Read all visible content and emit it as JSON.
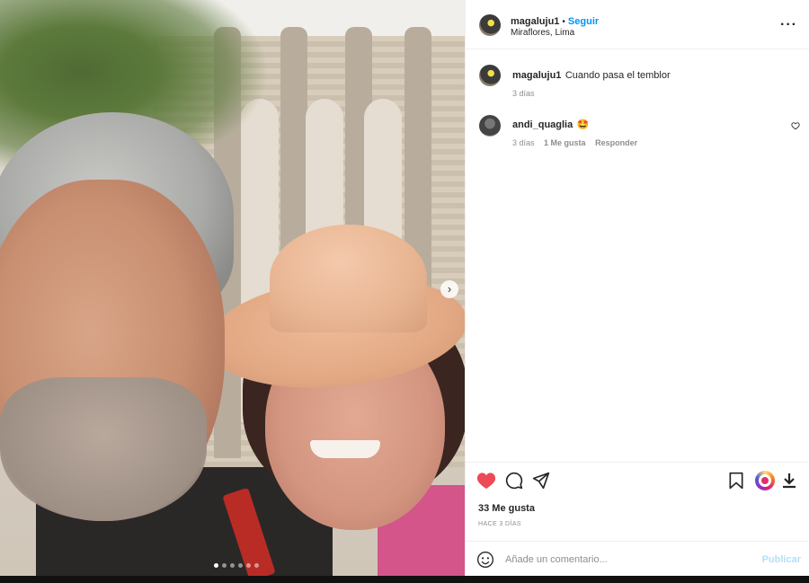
{
  "post": {
    "username": "magaluju1",
    "follow_label": "Seguir",
    "separator": "•",
    "location": "Miraflores, Lima",
    "more_label": "···",
    "carousel": {
      "total": 6,
      "active_index": 0
    }
  },
  "caption": {
    "username": "magaluju1",
    "text": "Cuando pasa el temblor",
    "time": "3 días"
  },
  "comments": [
    {
      "username": "andi_quaglia",
      "text": "🤩",
      "time": "3 días",
      "likes_label": "1 Me gusta",
      "reply_label": "Responder"
    }
  ],
  "actions": {
    "liked": true,
    "like_icon": "heart-icon",
    "comment_icon": "comment-icon",
    "share_icon": "share-icon",
    "save_icon": "bookmark-icon",
    "extension_icon": "instagram-extension-icon",
    "download_icon": "download-icon",
    "colors": {
      "like": "#ed4956",
      "link": "#0095f6",
      "publish_disabled": "#b2dffc"
    }
  },
  "likes": "33 Me gusta",
  "posted_ago": "HACE 3 DÍAS",
  "comment_box": {
    "placeholder": "Añade un comentario...",
    "publish_label": "Publicar",
    "emoji_icon": "emoji-icon"
  }
}
